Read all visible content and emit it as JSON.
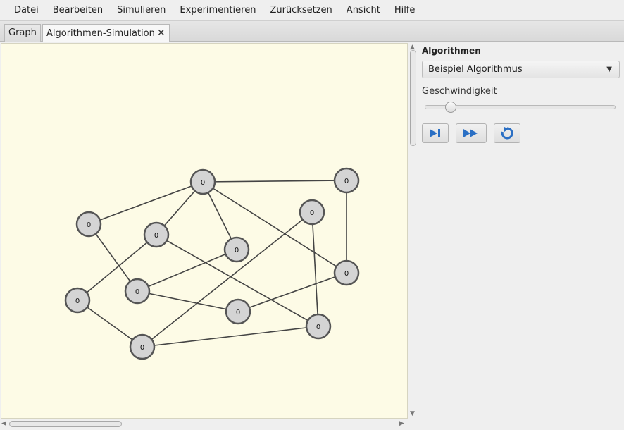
{
  "menu": [
    "Datei",
    "Bearbeiten",
    "Simulieren",
    "Experimentieren",
    "Zurücksetzen",
    "Ansicht",
    "Hilfe"
  ],
  "tabs": [
    {
      "label": "Graph",
      "active": false
    },
    {
      "label": "Algorithmen-Simulation",
      "active": true,
      "close": "✕"
    }
  ],
  "graph": {
    "node_value": "0",
    "node_fill": "#d4d4d4",
    "node_stroke": "#555555",
    "edge_color": "#444444",
    "background": "#fdfbe6"
  },
  "side": {
    "title": "Algorithmen",
    "algorithm_selected": "Beispiel Algorithmus",
    "speed_label": "Geschwindigkeit",
    "speed_level": 0.12,
    "buttons": [
      "step-icon",
      "fast-forward-icon",
      "reset-icon"
    ],
    "accent": "#2a6fc4"
  }
}
